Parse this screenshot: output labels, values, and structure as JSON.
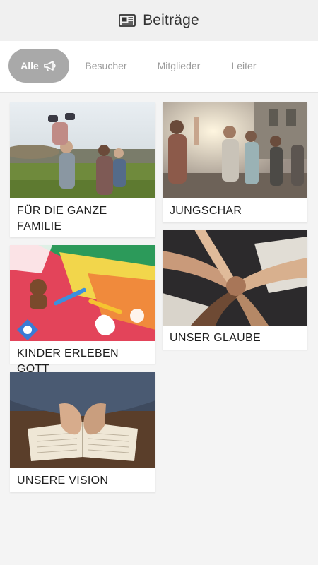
{
  "header": {
    "title": "Beiträge",
    "icon": "newspaper-icon"
  },
  "tabs": [
    {
      "label": "Alle",
      "active": true,
      "icon": "megaphone-icon"
    },
    {
      "label": "Besucher",
      "active": false
    },
    {
      "label": "Mitglieder",
      "active": false
    },
    {
      "label": "Leiter",
      "active": false
    }
  ],
  "cards": [
    {
      "title": "FÜR DIE GANZE FAMILIE",
      "image": "family-photo"
    },
    {
      "title": "JUNGSCHAR",
      "image": "youth-group-photo"
    },
    {
      "title": "KINDER ERLEBEN GOTT",
      "image": "kids-crafts-photo"
    },
    {
      "title": "UNSER GLAUBE",
      "image": "hands-together-photo"
    },
    {
      "title": "UNSERE VISION",
      "image": "praying-hands-bible-photo"
    }
  ],
  "colors": {
    "active_tab": "#a9a9a9",
    "tab_text": "#9a9a9a",
    "header_bg": "#f0f0f0",
    "page_bg": "#f4f4f4"
  }
}
